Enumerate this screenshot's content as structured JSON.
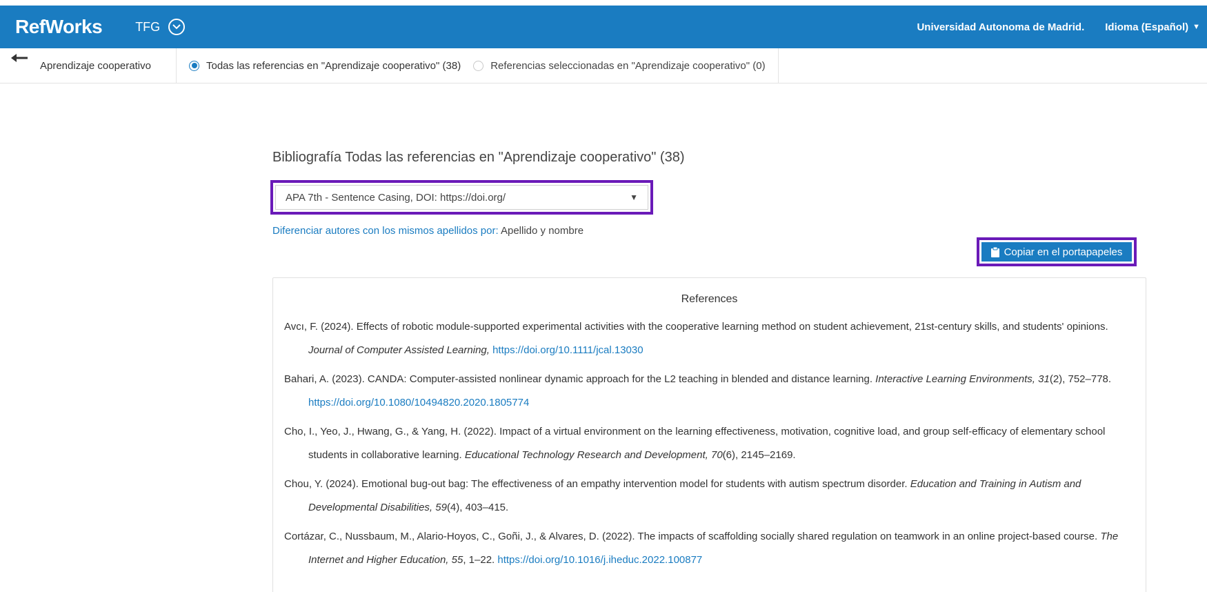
{
  "header": {
    "logo": "RefWorks",
    "project": "TFG",
    "institution": "Universidad Autonoma de Madrid.",
    "language": "Idioma (Español)"
  },
  "subbar": {
    "folder": "Aprendizaje cooperativo",
    "scope_all": "Todas las referencias en \"Aprendizaje cooperativo\" (38)",
    "scope_selected": "Referencias seleccionadas en \"Aprendizaje cooperativo\" (0)"
  },
  "bibliography": {
    "title": "Bibliografía Todas las referencias en \"Aprendizaje cooperativo\" (38)",
    "style_selected": "APA 7th - Sentence Casing, DOI: https://doi.org/",
    "disambiguate_label": "Diferenciar autores con los mismos apellidos por:",
    "disambiguate_value": " Apellido y nombre",
    "copy_button": "Copiar en el portapapeles",
    "references_heading": "References"
  },
  "references": [
    {
      "text": "Avcı, F. (2024). Effects of robotic module-supported experimental activities with the cooperative learning method on student achievement, 21st-century skills, and students' opinions. ",
      "source": "Journal of Computer Assisted Learning,",
      "details": " ",
      "doi": "https://doi.org/10.1111/jcal.13030"
    },
    {
      "text": "Bahari, A. (2023). CANDA: Computer-assisted nonlinear dynamic approach for the L2 teaching in blended and distance learning. ",
      "source": "Interactive Learning Environments, 31",
      "details": "(2), 752–778. ",
      "doi": "https://doi.org/10.1080/10494820.2020.1805774"
    },
    {
      "text": "Cho, I., Yeo, J., Hwang, G., & Yang, H. (2022). Impact of a virtual environment on the learning effectiveness, motivation, cognitive load, and group self-efficacy of elementary school students in collaborative learning. ",
      "source": "Educational Technology Research and Development, 70",
      "details": "(6), 2145–2169.",
      "doi": ""
    },
    {
      "text": "Chou, Y. (2024). Emotional bug-out bag: The effectiveness of an empathy intervention model for students with autism spectrum disorder. ",
      "source": "Education and Training in Autism and Developmental Disabilities, 59",
      "details": "(4), 403–415.",
      "doi": ""
    },
    {
      "text": "Cortázar, C., Nussbaum, M., Alario-Hoyos, C., Goñi, J., & Alvares, D. (2022). The impacts of scaffolding socially shared regulation on teamwork in an online project-based course. ",
      "source": "The Internet and Higher Education, 55",
      "details": ", 1–22. ",
      "doi": "https://doi.org/10.1016/j.iheduc.2022.100877"
    }
  ],
  "colors": {
    "brand_blue": "#1a7cc1",
    "highlight_purple": "#6a1ab8"
  }
}
